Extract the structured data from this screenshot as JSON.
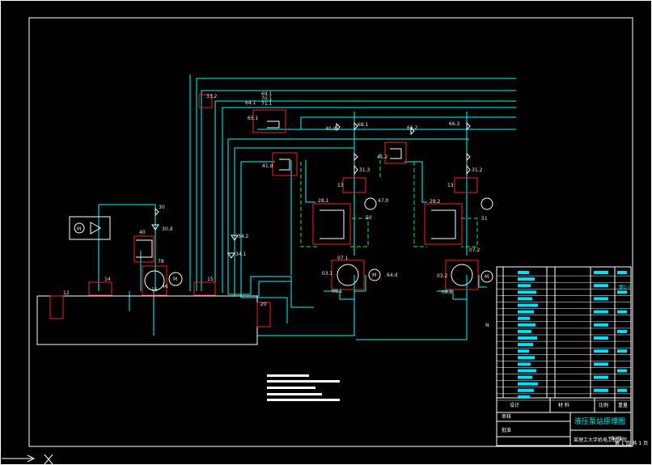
{
  "drawing": {
    "title": "液压泵站原理图",
    "version_mark": "图1-II",
    "sheet": "第 1 页 共 1 页",
    "institution": "某理工大学机电工程学院",
    "designer_label": "设计",
    "checker_label": "审核",
    "approver_label": "批准",
    "material_label": "材 料",
    "scale_label": "比例",
    "weight_label": "重量",
    "drawing_no": "YB-01"
  },
  "labels": {
    "l33_2": "33.2",
    "l64_1": "64.1",
    "l69_1": "69.1",
    "l70_1": "70.1",
    "l71_1": "71.1",
    "l65_1": "65.1",
    "l40_d": "40.d",
    "l68_1": "68.1",
    "l66_2": "66.2",
    "l66_3": "66.3",
    "l41_d": "41.d",
    "l41_2": "41.2",
    "l31_3": "31.3",
    "l31_2": "31.2",
    "l13": "13",
    "l13b": "13",
    "l47_0": "47.0",
    "l28_1": "28.1",
    "l28_2": "28.2",
    "l50": "50",
    "l51": "51",
    "l34_2": "34.2",
    "l34_1": "34.1",
    "l30": "30",
    "l30_d": "30.d",
    "l40": "40",
    "l78": "78",
    "lM1": "M",
    "lM2": "M",
    "lM3": "M",
    "lM4": "M",
    "l14": "14",
    "l15": "15",
    "l16": "16",
    "l12": "12",
    "l20": "20",
    "l07_1": "07.1",
    "l07_2": "07.2",
    "l03_1": "03.1",
    "l03_2": "03.2",
    "l08_1": "08.1",
    "l08_2": "08.2",
    "l64_d": "64.d",
    "l46": "46",
    "lN": "N"
  },
  "colors": {
    "pipe": "#00ffff",
    "pipe_alt": "#00ff66",
    "component_box": "#ff2020",
    "frame": "#ffffff",
    "symbol": "#ffffff",
    "table_fill": "#00e0ff"
  }
}
